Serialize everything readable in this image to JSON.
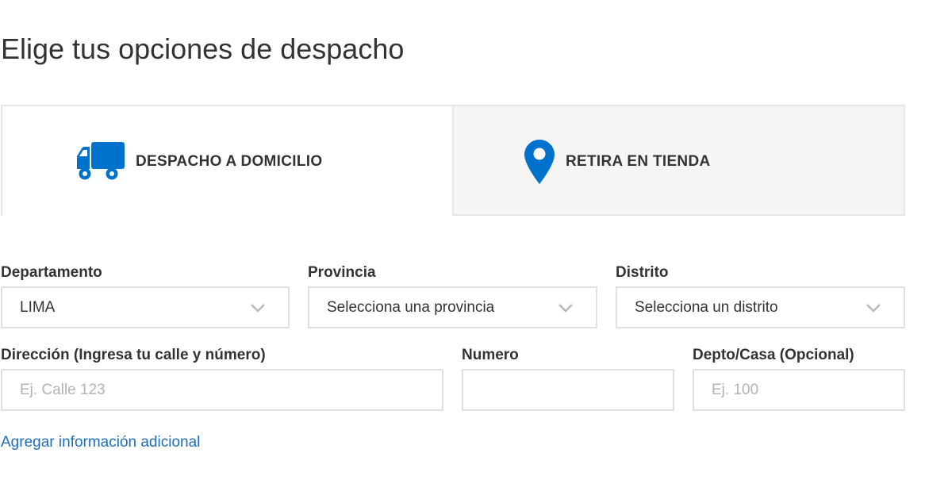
{
  "page": {
    "title": "Elige tus opciones de despacho"
  },
  "tabs": [
    {
      "label": "DESPACHO A DOMICILIO",
      "icon": "truck-icon",
      "selected": true
    },
    {
      "label": "RETIRA EN TIENDA",
      "icon": "location-pin-icon",
      "selected": false
    }
  ],
  "form": {
    "departamento": {
      "label": "Departamento",
      "value": "LIMA"
    },
    "provincia": {
      "label": "Provincia",
      "value": "Selecciona una provincia"
    },
    "distrito": {
      "label": "Distrito",
      "value": "Selecciona un distrito"
    },
    "direccion": {
      "label": "Dirección (Ingresa tu calle y número)",
      "placeholder": "Ej. Calle 123",
      "value": ""
    },
    "numero": {
      "label": "Numero",
      "placeholder": "",
      "value": ""
    },
    "depto": {
      "label": "Depto/Casa (Opcional)",
      "placeholder": "Ej. 100",
      "value": ""
    }
  },
  "additional_info_link": "Agregar información adicional",
  "colors": {
    "accent": "#0072ce",
    "link": "#1f6fb8",
    "text": "#333333",
    "border": "#e0e0e0",
    "inactive_tab_bg": "#f5f5f5"
  }
}
